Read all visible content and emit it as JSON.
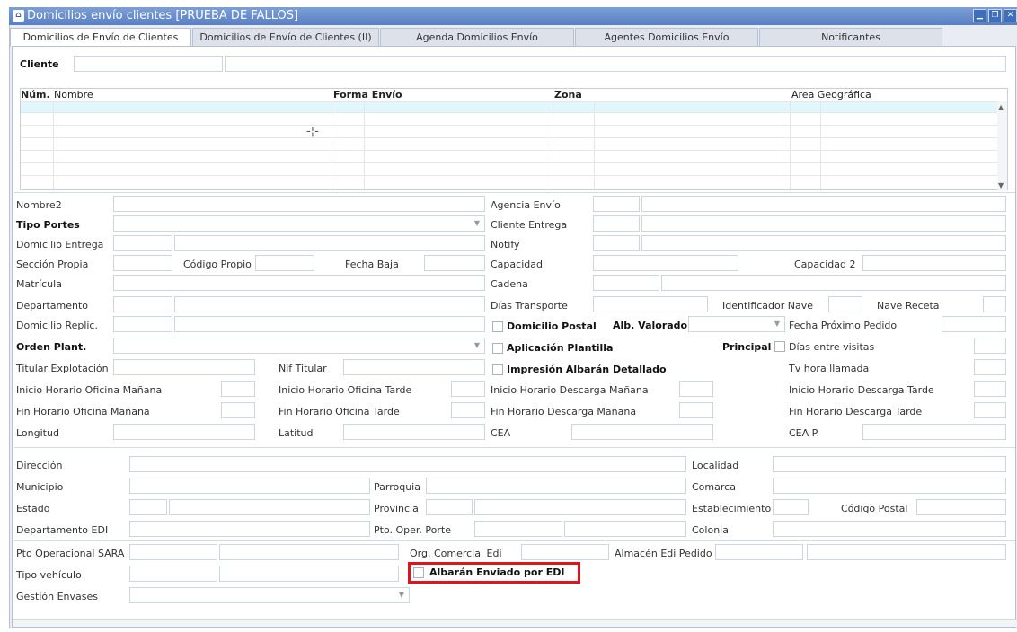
{
  "window": {
    "title": "Domicilios envío clientes [PRUEBA DE FALLOS]",
    "controls": [
      "minimize-icon",
      "restore-icon",
      "close-icon"
    ]
  },
  "tabs": [
    {
      "label": "Domicilios de Envío de Clientes",
      "active": true
    },
    {
      "label": "Domicilios de Envío de Clientes (II)",
      "active": false
    },
    {
      "label": "Agenda Domicilios Envío",
      "active": false
    },
    {
      "label": "Agentes Domicilios Envío",
      "active": false
    },
    {
      "label": "Notificantes",
      "active": false
    }
  ],
  "cliente": {
    "label": "Cliente",
    "code": "",
    "name": ""
  },
  "grid": {
    "columns": [
      "Núm.",
      "Nombre",
      "Forma Envío",
      "Zona",
      "Area Geográfica"
    ],
    "rows": [
      "",
      "",
      "",
      "",
      "",
      "",
      ""
    ]
  },
  "labels": {
    "nombre2": "Nombre2",
    "tipo_portes": "Tipo Portes",
    "domicilio_entrega": "Domicilio Entrega",
    "seccion_propia": "Sección Propia",
    "codigo_propio": "Código Propio",
    "fecha_baja": "Fecha Baja",
    "matricula": "Matrícula",
    "departamento": "Departamento",
    "domicilio_replic": "Domicilio Replic.",
    "orden_plant": "Orden Plant.",
    "titular_explotacion": "Titular Explotación",
    "nif_titular": "Nif Titular",
    "inicio_ofi_manana": "Inicio Horario Oficina Mañana",
    "inicio_ofi_tarde": "Inicio Horario Oficina Tarde",
    "fin_ofi_manana": "Fin Horario Oficina Mañana",
    "fin_ofi_tarde": "Fin Horario Oficina Tarde",
    "longitud": "Longitud",
    "latitud": "Latitud",
    "agencia_envio": "Agencia Envío",
    "cliente_entrega": "Cliente Entrega",
    "notify": "Notify",
    "capacidad": "Capacidad",
    "capacidad2": "Capacidad 2",
    "cadena": "Cadena",
    "dias_transporte": "Días Transporte",
    "identificador_nave": "Identificador Nave",
    "nave_receta": "Nave Receta",
    "domicilio_postal": "Domicilio Postal",
    "alb_valorado": "Alb. Valorado",
    "fecha_proximo_pedido": "Fecha Próximo Pedido",
    "aplicacion_plantilla": "Aplicación Plantilla",
    "principal": "Principal",
    "dias_entre_visitas": "Días entre visitas",
    "impresion_albaran": "Impresión Albarán Detallado",
    "tv_hora_llamada": "Tv hora llamada",
    "inicio_desc_manana": "Inicio Horario Descarga Mañana",
    "inicio_desc_tarde": "Inicio Horario Descarga Tarde",
    "fin_desc_manana": "Fin Horario Descarga Mañana",
    "fin_desc_tarde": "Fin Horario Descarga Tarde",
    "cea": "CEA",
    "cea_p": "CEA P.",
    "direccion": "Dirección",
    "localidad": "Localidad",
    "municipio": "Municipio",
    "parroquia": "Parroquia",
    "comarca": "Comarca",
    "estado": "Estado",
    "provincia": "Provincia",
    "establecimiento": "Establecimiento",
    "codigo_postal": "Código Postal",
    "departamento_edi": "Departamento EDI",
    "pto_oper_porte": "Pto. Oper. Porte",
    "colonia": "Colonia",
    "pto_operacional_sara": "Pto Operacional SARA",
    "org_comercial_edi": "Org. Comercial Edi",
    "almacen_edi_pedido": "Almacén Edi Pedido",
    "tipo_vehiculo": "Tipo vehículo",
    "albaran_enviado_edi": "Albarán Enviado por EDI",
    "gestion_envases": "Gestión Envases"
  }
}
